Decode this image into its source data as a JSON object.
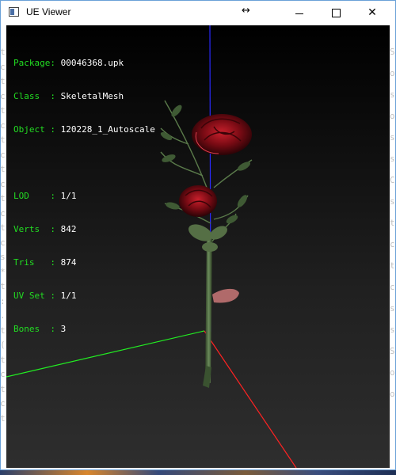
{
  "window": {
    "title": "UE Viewer",
    "resize_glyph": "↔",
    "close_glyph": "✕"
  },
  "background_terminal": {
    "left_chars": [
      "t",
      "c",
      "t",
      "c",
      "t",
      "c",
      "t",
      "c",
      "t",
      "c",
      "t",
      "c",
      "t",
      "c",
      "s",
      "*",
      "t",
      ":",
      ".",
      "t",
      "(",
      "t",
      "c",
      "t",
      "c",
      "t"
    ],
    "right_chars": [
      "S",
      "o",
      "s",
      "o",
      "s",
      "s",
      "C",
      "s",
      "t",
      "c",
      "t",
      "c",
      "s",
      "s",
      "S",
      "o",
      "o"
    ]
  },
  "hud": {
    "package": {
      "key": "Package",
      "value": "00046368.upk"
    },
    "class": {
      "key": "Class  ",
      "value": "SkeletalMesh"
    },
    "object": {
      "key": "Object ",
      "value": "120228_1_Autoscale"
    },
    "lod": {
      "key": "LOD    ",
      "value": "1/1"
    },
    "verts": {
      "key": "Verts  ",
      "value": "842"
    },
    "tris": {
      "key": "Tris   ",
      "value": "874"
    },
    "uvset": {
      "key": "UV Set ",
      "value": "1/1"
    },
    "bones": {
      "key": "Bones  ",
      "value": "3"
    }
  },
  "colors": {
    "hud_key": "#22dd22",
    "hud_value": "#ffffff",
    "axis_x": "#ff2020",
    "axis_y": "#20ff20",
    "axis_z": "#2020ff",
    "flower": "#8a0f18",
    "stem": "#4a6a3a"
  }
}
